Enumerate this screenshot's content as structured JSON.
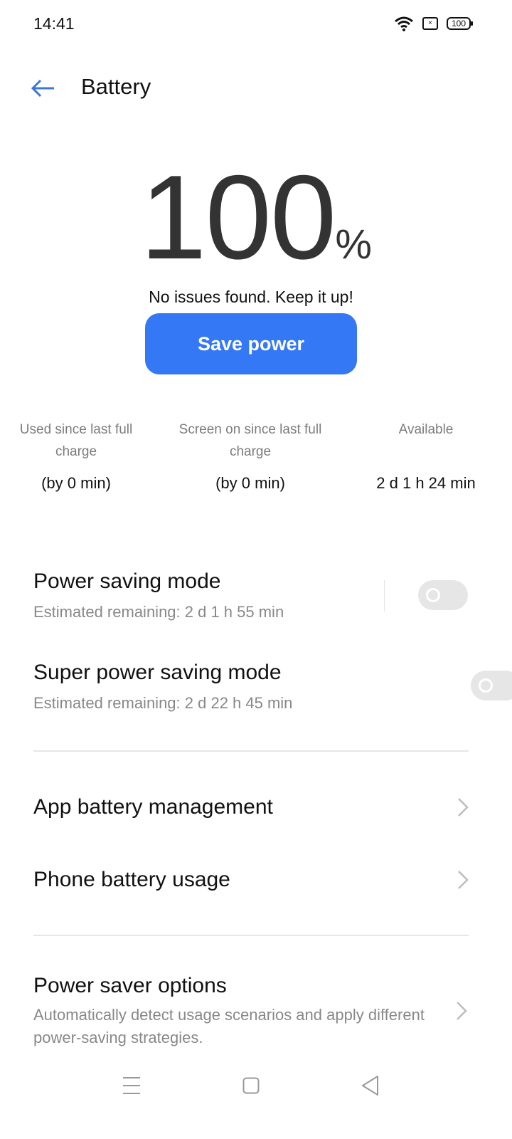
{
  "status_bar": {
    "time": "14:41",
    "battery_level": "100",
    "icons": [
      "wifi-icon",
      "sim-card-icon",
      "battery-icon"
    ]
  },
  "header": {
    "title": "Battery",
    "back_icon": "arrow-left-icon"
  },
  "battery": {
    "percent_value": "100",
    "percent_sign": "%",
    "status_message": "No issues found. Keep it up!",
    "save_button_label": "Save power"
  },
  "stats": [
    {
      "label": "Used since last full charge",
      "value": "(by 0 min)"
    },
    {
      "label": "Screen on since last full charge",
      "value": "(by 0 min)"
    },
    {
      "label": "Available",
      "value": "2 d 1 h 24 min"
    }
  ],
  "modes": [
    {
      "title": "Power saving mode",
      "subtitle": "Estimated remaining:  2 d 1 h 55 min",
      "enabled": false
    },
    {
      "title": "Super power saving mode",
      "subtitle": "Estimated remaining:  2 d 22 h 45 min",
      "enabled": false
    }
  ],
  "menu": [
    {
      "label": "App battery management"
    },
    {
      "label": "Phone battery usage"
    }
  ],
  "power_saver_options": {
    "title": "Power saver options",
    "description": "Automatically detect usage scenarios and apply different power-saving strategies."
  },
  "colors": {
    "accent": "#3478f6",
    "toggle_off": "#e6e6e6",
    "secondary_text": "#888888"
  }
}
